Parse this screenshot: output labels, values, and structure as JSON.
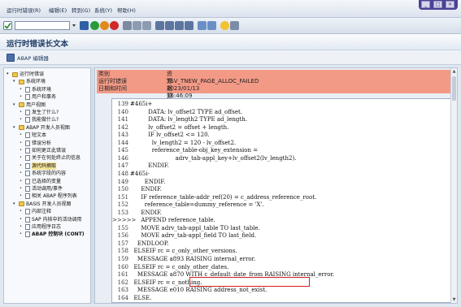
{
  "menu": {
    "items": [
      "运行时错误(R)",
      "编辑(E)",
      "转到(G)",
      "系统(Y)",
      "帮助(H)"
    ]
  },
  "window_controls": [
    "_",
    "□",
    "×"
  ],
  "page": {
    "title": "运行时错误长文本"
  },
  "toolbar2": {
    "abap_editor_label": "ABAP 编辑器"
  },
  "sidebar": {
    "items": [
      {
        "label": "运行时错误",
        "level": 0,
        "type": "folder",
        "bold": false
      },
      {
        "label": "系统环境",
        "level": 1,
        "type": "folder",
        "bold": false
      },
      {
        "label": "系统环境",
        "level": 2,
        "type": "doc",
        "bold": false
      },
      {
        "label": "用户和事务",
        "level": 2,
        "type": "doc",
        "bold": false
      },
      {
        "label": "用户视图",
        "level": 1,
        "type": "folder",
        "bold": false
      },
      {
        "label": "发生了什么?",
        "level": 2,
        "type": "doc",
        "bold": false
      },
      {
        "label": "我能做什么?",
        "level": 2,
        "type": "doc",
        "bold": false
      },
      {
        "label": "ABAP 开发人员视图",
        "level": 1,
        "type": "folder",
        "bold": false
      },
      {
        "label": "短文本",
        "level": 2,
        "type": "doc",
        "bold": false
      },
      {
        "label": "错误分析",
        "level": 2,
        "type": "doc",
        "bold": false
      },
      {
        "label": "如何更正此错误",
        "level": 2,
        "type": "doc",
        "bold": false
      },
      {
        "label": "关于在何处终止的信息",
        "level": 2,
        "type": "doc",
        "bold": false
      },
      {
        "label": "源代码摘取",
        "level": 2,
        "type": "doc",
        "bold": false,
        "selected": true
      },
      {
        "label": "系统字段的内容",
        "level": 2,
        "type": "doc",
        "bold": false
      },
      {
        "label": "已选择的变量",
        "level": 2,
        "type": "doc",
        "bold": false
      },
      {
        "label": "活动调用/事件",
        "level": 2,
        "type": "doc",
        "bold": false
      },
      {
        "label": "相关 ABAP 程序列表",
        "level": 2,
        "type": "doc",
        "bold": false
      },
      {
        "label": "BASIS 开发人员视图",
        "level": 1,
        "type": "folder",
        "bold": false
      },
      {
        "label": "内部注释",
        "level": 2,
        "type": "doc",
        "bold": false
      },
      {
        "label": "SAP 内核中的活动调用",
        "level": 2,
        "type": "doc",
        "bold": false
      },
      {
        "label": "应用程序日志",
        "level": 2,
        "type": "doc",
        "bold": false
      },
      {
        "label": "ABAP 控制块 (CONT)",
        "level": 2,
        "type": "doc",
        "bold": true
      }
    ]
  },
  "header": {
    "rows": [
      {
        "label": "类别",
        "value": "资源瓶颈"
      },
      {
        "label": "运行时错误",
        "value": "TSV_TNEW_PAGE_ALLOC_FAILED"
      },
      {
        "label": "日期和时间",
        "value": "2023/01/13 16:46:09"
      }
    ]
  },
  "code": {
    "lines": [
      {
        "n": "139",
        "t": "#465i+"
      },
      {
        "n": "140",
        "t": "          DATA: lv_offset2 TYPE ad_offset."
      },
      {
        "n": "141",
        "t": "          DATA: lv_length2 TYPE ad_length."
      },
      {
        "n": "142",
        "t": "          lv_offset2 = offset + length."
      },
      {
        "n": "143",
        "t": "          IF lv_offset2 <= 120."
      },
      {
        "n": "144",
        "t": "            lv_length2 = 120 - lv_offset2."
      },
      {
        "n": "145",
        "t": "            reference_table-obj_key_extension ="
      },
      {
        "n": "146",
        "t": "                         adrv_tab-appl_key+lv_offset2(lv_length2)."
      },
      {
        "n": "147",
        "t": "          ENDIF."
      },
      {
        "n": "148",
        "t": "#465i-"
      },
      {
        "n": "149",
        "t": "        ENDIF."
      },
      {
        "n": "150",
        "t": "      ENDIF."
      },
      {
        "n": "151",
        "t": "      IF reference_table-addr_ref(20) = c_address_reference_root."
      },
      {
        "n": "152",
        "t": "        reference_table=dummy_reference = 'X'."
      },
      {
        "n": "153",
        "t": "      ENDIF."
      },
      {
        "n": ">>>>>",
        "t": "      APPEND reference_table."
      },
      {
        "n": "155",
        "t": "      MOVE adrv_tab-appl_table TO last_table."
      },
      {
        "n": "156",
        "t": "      MOVE adrv_tab-appl_field TO last_field."
      },
      {
        "n": "157",
        "t": "    ENDLOOP."
      },
      {
        "n": "158",
        "t": "  ELSEIF rc = c_only_other_versions."
      },
      {
        "n": "159",
        "t": "    MESSAGE a893 RAISING internal_error."
      },
      {
        "n": "160",
        "t": "  ELSEIF rc = c_only_other_dates."
      },
      {
        "n": "161",
        "t": "    MESSAGE a870 WITH c_default_date_from RAISING internal_error."
      },
      {
        "n": "162",
        "t": "  ELSEIF rc = c_nothing."
      },
      {
        "n": "163",
        "t": "    MESSAGE e010 RAISING address_not_exist."
      },
      {
        "n": "164",
        "t": "  ELSE."
      }
    ]
  },
  "colors": {
    "header_bg": "#f39a86",
    "highlight_border": "#d02020",
    "title_text": "#1d3a63"
  }
}
